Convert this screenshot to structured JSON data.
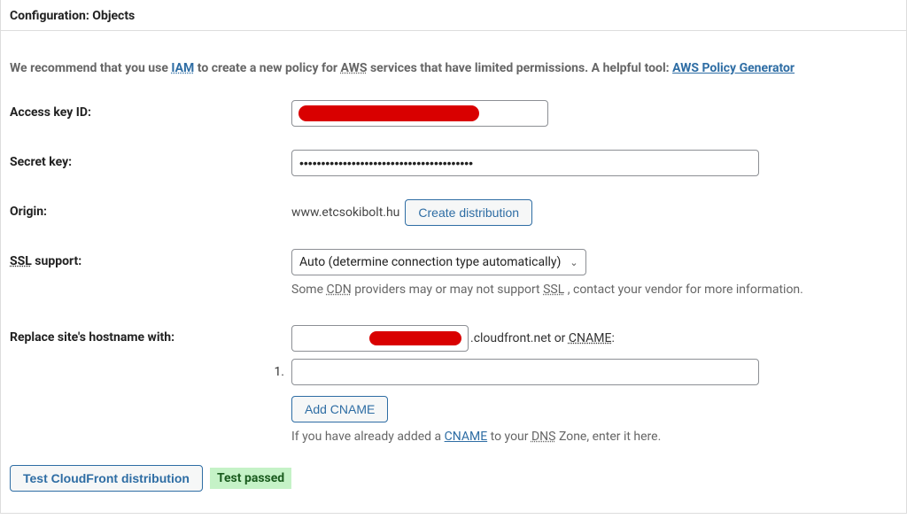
{
  "header": {
    "title": "Configuration: Objects"
  },
  "recommend": {
    "pre": "We recommend that you use ",
    "iam": "IAM",
    "mid": " to create a new policy for ",
    "aws": "AWS",
    "post": " services that have limited permissions. A helpful tool: ",
    "link_text": "AWS Policy Generator"
  },
  "labels": {
    "access_key": "Access key ID:",
    "secret_key": "Secret key:",
    "origin": "Origin:",
    "ssl_pre": "",
    "ssl_abbr": "SSL",
    "ssl_post": " support:",
    "replace_hostname": "Replace site's hostname with:"
  },
  "fields": {
    "access_key_value": "",
    "secret_key_value": "••••••••••••••••••••••••••••••••••••••••",
    "origin_value": "www.etcsokibolt.hu",
    "ssl_selected": "Auto (determine connection type automatically)",
    "hostname_value": "",
    "cname_value": ""
  },
  "buttons": {
    "create_distribution": "Create distribution",
    "add_cname": "Add CNAME",
    "test_cf": "Test CloudFront distribution"
  },
  "helptext": {
    "ssl_pre": "Some ",
    "ssl_cdn": "CDN",
    "ssl_mid": " providers may or may not support ",
    "ssl_ssl": "SSL",
    "ssl_post": ", contact your vendor for more information.",
    "hostname_suffix_pre": ".cloudfront.net or ",
    "hostname_cname": "CNAME",
    "hostname_suffix_post": ":",
    "cname_help_pre": "If you have already added a ",
    "cname_help_cname": "CNAME",
    "cname_help_mid": " to your ",
    "cname_help_dns": "DNS",
    "cname_help_post": " Zone, enter it here."
  },
  "cname_list": {
    "index_1": "1."
  },
  "status": {
    "test_passed": "Test passed"
  }
}
